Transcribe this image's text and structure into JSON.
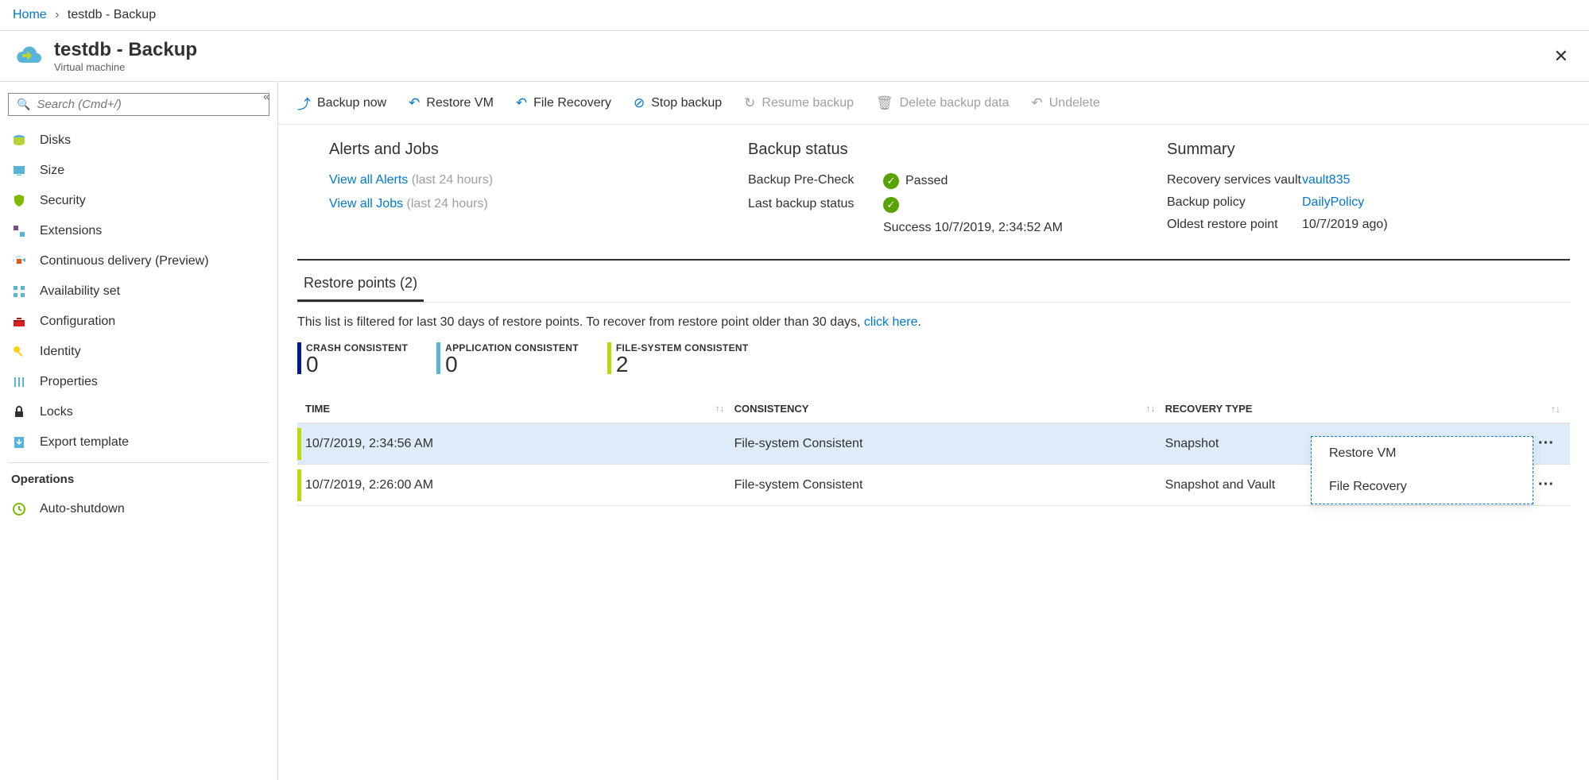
{
  "breadcrumb": {
    "home": "Home",
    "current": "testdb - Backup"
  },
  "header": {
    "title": "testdb - Backup",
    "subtitle": "Virtual machine"
  },
  "search": {
    "placeholder": "Search (Cmd+/)"
  },
  "sidebar": {
    "items": [
      {
        "label": "Disks"
      },
      {
        "label": "Size"
      },
      {
        "label": "Security"
      },
      {
        "label": "Extensions"
      },
      {
        "label": "Continuous delivery (Preview)"
      },
      {
        "label": "Availability set"
      },
      {
        "label": "Configuration"
      },
      {
        "label": "Identity"
      },
      {
        "label": "Properties"
      },
      {
        "label": "Locks"
      },
      {
        "label": "Export template"
      }
    ],
    "section": "Operations",
    "autoShutdown": "Auto-shutdown"
  },
  "toolbar": {
    "backupNow": "Backup now",
    "restoreVm": "Restore VM",
    "fileRecovery": "File Recovery",
    "stopBackup": "Stop backup",
    "resumeBackup": "Resume backup",
    "deleteBackupData": "Delete backup data",
    "undelete": "Undelete"
  },
  "overview": {
    "alertsTitle": "Alerts and Jobs",
    "viewAlerts": "View all Alerts",
    "viewJobs": "View all Jobs",
    "last24": "(last 24 hours)",
    "statusTitle": "Backup status",
    "preCheckLabel": "Backup Pre-Check",
    "preCheckVal": "Passed",
    "lastBackupLabel": "Last backup status",
    "lastBackupVal": "Success 10/7/2019, 2:34:52 AM",
    "summaryTitle": "Summary",
    "vaultLabel": "Recovery services vault",
    "vaultVal": "vault835",
    "policyLabel": "Backup policy",
    "policyVal": "DailyPolicy",
    "oldestLabel": "Oldest restore point",
    "oldestVal": "10/7/2019 ago)"
  },
  "tabs": {
    "restorePoints": "Restore points (2)"
  },
  "filterNote": {
    "text": "This list is filtered for last 30 days of restore points. To recover from restore point older than 30 days, ",
    "link": "click here"
  },
  "counters": {
    "crash": {
      "label": "CRASH CONSISTENT",
      "count": "0"
    },
    "app": {
      "label": "APPLICATION CONSISTENT",
      "count": "0"
    },
    "fs": {
      "label": "FILE-SYSTEM CONSISTENT",
      "count": "2"
    }
  },
  "table": {
    "cols": {
      "time": "TIME",
      "consistency": "CONSISTENCY",
      "recovery": "RECOVERY TYPE"
    },
    "rows": [
      {
        "time": "10/7/2019, 2:34:56 AM",
        "consistency": "File-system Consistent",
        "recovery": "Snapshot"
      },
      {
        "time": "10/7/2019, 2:26:00 AM",
        "consistency": "File-system Consistent",
        "recovery": "Snapshot and Vault"
      }
    ]
  },
  "contextMenu": {
    "restoreVm": "Restore VM",
    "fileRecovery": "File Recovery"
  }
}
